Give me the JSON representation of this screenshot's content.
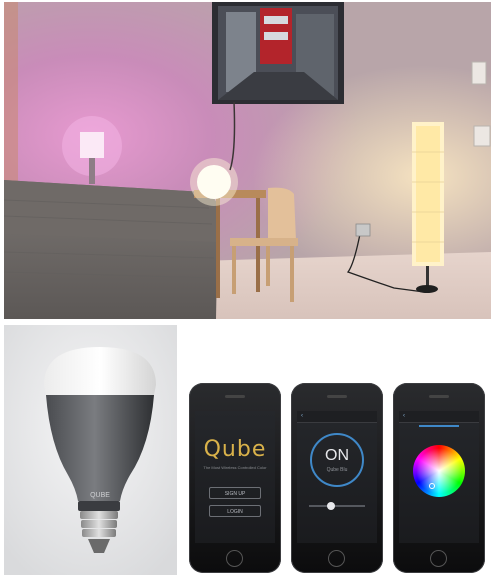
{
  "room_scene": {
    "description_icons": [
      "lamp-icon",
      "pendant-bulb-icon",
      "floor-lamp-icon"
    ]
  },
  "bulb_product": {
    "brand_mark": "QUBE"
  },
  "app_screens": {
    "login": {
      "logo": "Qube",
      "tagline": "The Most Wireless Controlled Color",
      "signup_label": "SIGN UP",
      "login_label": "LOGIN"
    },
    "control": {
      "header": "‹",
      "state": "ON",
      "sub": "Qube Blu"
    },
    "color": {
      "header": "‹"
    }
  },
  "colors": {
    "accent_blue": "#3f88c8",
    "logo_gold": "#d9b24a",
    "wall_pink": "#d98ab8"
  }
}
